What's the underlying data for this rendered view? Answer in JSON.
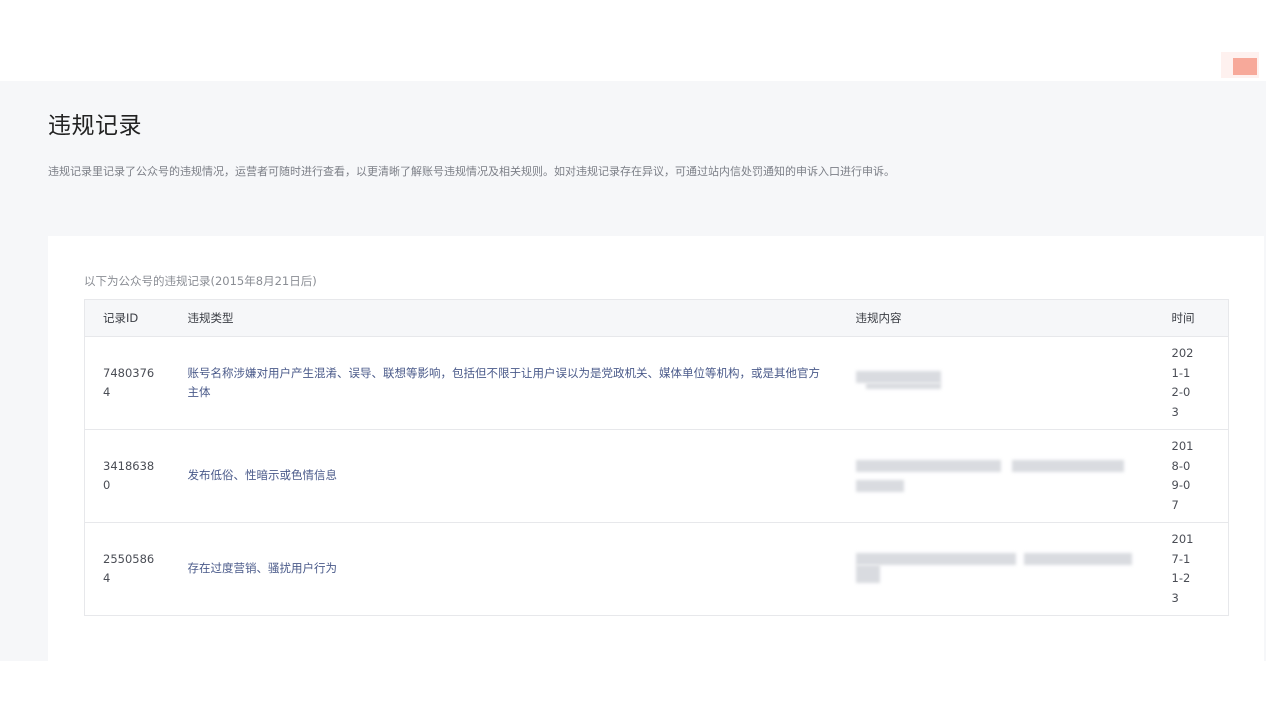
{
  "page": {
    "title": "违规记录",
    "description": "违规记录里记录了公众号的违规情况，运营者可随时进行查看，以更清晰了解账号违规情况及相关规则。如对违规记录存在异议，可通过站内信处罚通知的申诉入口进行申诉。"
  },
  "records_card": {
    "caption": "以下为公众号的违规记录(2015年8月21日后)",
    "columns": {
      "id": "记录ID",
      "type": "违规类型",
      "content": "违规内容",
      "time": "时间"
    },
    "rows": [
      {
        "id": "74803764",
        "type": "账号名称涉嫌对用户产生混淆、误导、联想等影响，包括但不限于让用户误以为是党政机关、媒体单位等机构，或是其他官方主体",
        "content": "",
        "time": "2021-12-03"
      },
      {
        "id": "34186380",
        "type": "发布低俗、性暗示或色情信息",
        "content": "",
        "time": "2018-09-07"
      },
      {
        "id": "25505864",
        "type": "存在过度营销、骚扰用户行为",
        "content": "",
        "time": "2017-11-23"
      }
    ]
  },
  "colors": {
    "page_background": "#f6f7f9",
    "violation_type_text": "#4a5a8a",
    "corner_mark": "#f7a99a"
  }
}
